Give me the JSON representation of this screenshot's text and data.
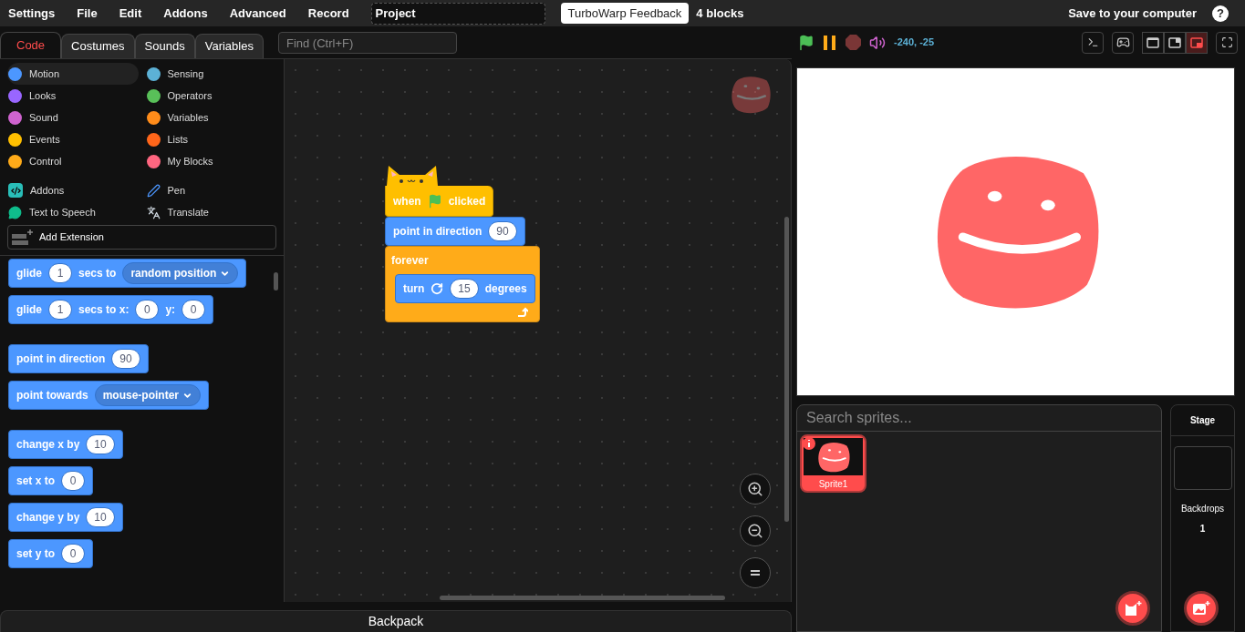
{
  "menu_bar": {
    "items": [
      {
        "label": "Settings"
      },
      {
        "label": "File"
      },
      {
        "label": "Edit"
      },
      {
        "label": "Addons"
      },
      {
        "label": "Advanced"
      },
      {
        "label": "Record"
      }
    ],
    "project_title": "Project",
    "feedback_button": "TurboWarp Feedback",
    "block_count": "4 blocks",
    "save_link": "Save to your computer",
    "help": "?"
  },
  "tabs": [
    {
      "label": "Code",
      "selected": true
    },
    {
      "label": "Costumes",
      "selected": false
    },
    {
      "label": "Sounds",
      "selected": false
    },
    {
      "label": "Variables",
      "selected": false
    }
  ],
  "find": {
    "placeholder": "Find (Ctrl+F)"
  },
  "categories": [
    {
      "label": "Motion",
      "color": "#4c97ff",
      "selected": true
    },
    {
      "label": "Sensing",
      "color": "#5cb1d6",
      "selected": false
    },
    {
      "label": "Looks",
      "color": "#9966ff",
      "selected": false
    },
    {
      "label": "Operators",
      "color": "#59c059",
      "selected": false
    },
    {
      "label": "Sound",
      "color": "#cf63cf",
      "selected": false
    },
    {
      "label": "Variables",
      "color": "#ff8c1a",
      "selected": false
    },
    {
      "label": "Events",
      "color": "#ffbf00",
      "selected": false
    },
    {
      "label": "Lists",
      "color": "#ff661a",
      "selected": false
    },
    {
      "label": "Control",
      "color": "#ffab19",
      "selected": false
    },
    {
      "label": "My Blocks",
      "color": "#ff6680",
      "selected": false
    }
  ],
  "extensions": [
    {
      "label": "Addons",
      "kind": "addons"
    },
    {
      "label": "Pen",
      "kind": "pen"
    },
    {
      "label": "Text to Speech",
      "kind": "speech"
    },
    {
      "label": "Translate",
      "kind": "translate"
    }
  ],
  "add_extension": "Add Extension",
  "palette": [
    {
      "parts": [
        {
          "kind": "text",
          "text": "glide"
        },
        {
          "kind": "number",
          "text": "1"
        },
        {
          "kind": "text",
          "text": "secs to"
        },
        {
          "kind": "dropdown",
          "text": "random position"
        }
      ]
    },
    {
      "parts": [
        {
          "kind": "text",
          "text": "glide"
        },
        {
          "kind": "number",
          "text": "1"
        },
        {
          "kind": "text",
          "text": "secs to x:"
        },
        {
          "kind": "number",
          "text": "0"
        },
        {
          "kind": "text",
          "text": "y:"
        },
        {
          "kind": "number",
          "text": "0"
        }
      ]
    },
    {
      "gap": true,
      "parts": [
        {
          "kind": "text",
          "text": "point in direction"
        },
        {
          "kind": "number",
          "text": "90"
        }
      ]
    },
    {
      "parts": [
        {
          "kind": "text",
          "text": "point towards"
        },
        {
          "kind": "dropdown",
          "text": "mouse-pointer"
        }
      ]
    },
    {
      "gap": true,
      "parts": [
        {
          "kind": "text",
          "text": "change x by"
        },
        {
          "kind": "number",
          "text": "10"
        }
      ]
    },
    {
      "parts": [
        {
          "kind": "text",
          "text": "set x to"
        },
        {
          "kind": "number",
          "text": "0"
        }
      ]
    },
    {
      "parts": [
        {
          "kind": "text",
          "text": "change y by"
        },
        {
          "kind": "number",
          "text": "10"
        }
      ]
    },
    {
      "parts": [
        {
          "kind": "text",
          "text": "set y to"
        },
        {
          "kind": "number",
          "text": "0"
        }
      ]
    }
  ],
  "script": [
    {
      "kind": "hat",
      "parts": [
        {
          "kind": "text",
          "text": "when"
        },
        {
          "kind": "flag"
        },
        {
          "kind": "text",
          "text": "clicked"
        }
      ]
    },
    {
      "kind": "stack",
      "parts": [
        {
          "kind": "text",
          "text": "point in direction"
        },
        {
          "kind": "number",
          "text": "90"
        }
      ]
    },
    {
      "kind": "c",
      "parts": [
        {
          "kind": "text",
          "text": "forever"
        }
      ],
      "inner": [
        {
          "kind": "stack",
          "parts": [
            {
              "kind": "text",
              "text": "turn"
            },
            {
              "kind": "rotate"
            },
            {
              "kind": "number",
              "text": "15"
            },
            {
              "kind": "text",
              "text": "degrees"
            }
          ]
        }
      ]
    }
  ],
  "stage_header": {
    "coordinates": "-240, -25",
    "mode_buttons": [
      {
        "kind": "small",
        "selected": false
      },
      {
        "kind": "large",
        "selected": false
      },
      {
        "kind": "split",
        "selected": true
      }
    ]
  },
  "sprite_pane": {
    "search_placeholder": "Search sprites...",
    "sprites": [
      {
        "name": "Sprite1",
        "selected": true
      }
    ]
  },
  "stage_pane": {
    "title": "Stage",
    "backdrops_label": "Backdrops",
    "backdrops_count": "1"
  },
  "backpack": "Backpack"
}
